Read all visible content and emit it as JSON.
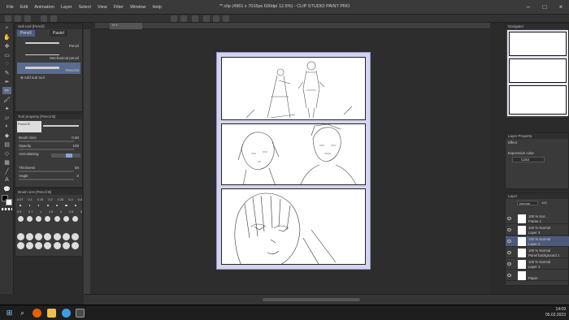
{
  "app": {
    "window_title": "**.clip (4961 x 7016px 600dpi 12.5%) - CLIP STUDIO PAINT PRO",
    "menu": [
      "File",
      "Edit",
      "Animation",
      "Layer",
      "Select",
      "View",
      "Filter",
      "Window",
      "Help"
    ]
  },
  "sub_tool": {
    "header": "Sub tool [Pencil]",
    "tabs": [
      "Pencil",
      "Pastel"
    ],
    "brushes": [
      {
        "label": "Pencil"
      },
      {
        "label": "Mechanical pencil"
      },
      {
        "label": "Pencil B"
      }
    ],
    "add_label": "Add sub tool"
  },
  "tool_property": {
    "header": "Tool property [Pencil B]",
    "preset": "Pencil B",
    "rows": [
      {
        "label": "Brush Size",
        "value": "0.50"
      },
      {
        "label": "Opacity",
        "value": "100"
      },
      {
        "label": "Anti-aliasing",
        "value": ""
      },
      {
        "label": "Thickness",
        "value": "50"
      },
      {
        "label": "Angle",
        "value": "0"
      }
    ]
  },
  "brush_size": {
    "header": "Brush size [Pencil B]",
    "row1": [
      "0.07",
      "0.1",
      "0.15",
      "0.2",
      "0.25",
      "0.3",
      "0.4"
    ],
    "row2": [
      "0.5",
      "0.7",
      "1",
      "1.5",
      "2",
      "2.5",
      "3"
    ]
  },
  "canvas": {
    "tab_label": "** *"
  },
  "navigator": {
    "header": "Navigator"
  },
  "layer_property": {
    "header": "Layer Property",
    "effect_label": "Effect",
    "expression_label": "Expression color",
    "expression_value": "Color"
  },
  "layer_panel": {
    "header": "Layer",
    "blend_mode": "Normal",
    "opacity": "100",
    "layers": [
      {
        "line1": "100 % Nor...",
        "line2": "Frame 1"
      },
      {
        "line1": "100 % Normal",
        "line2": "Layer 3"
      },
      {
        "line1": "100 % Normal",
        "line2": "Layer 2"
      },
      {
        "line1": "100 % Normal",
        "line2": "Panel background 1"
      },
      {
        "line1": "100 % Normal",
        "line2": "Layer 1"
      },
      {
        "line1": "",
        "line2": "Paper"
      }
    ]
  },
  "taskbar": {
    "time": "14:09",
    "date": "05.02.2023"
  },
  "colors": {
    "page_border": "#d4d4ee",
    "selection": "#5a6b90"
  }
}
